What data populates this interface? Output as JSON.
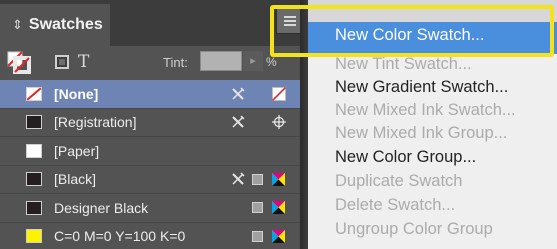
{
  "panel": {
    "title": "Swatches",
    "tint_label": "Tint:",
    "tint_value": "",
    "tint_pct": "%"
  },
  "swatches": [
    {
      "name": "[None]",
      "color": "#ffffff",
      "selected": true,
      "chip": "none",
      "nonedit": true,
      "mode": "none"
    },
    {
      "name": "[Registration]",
      "color": "#231f20",
      "selected": false,
      "chip": "solid",
      "nonedit": true,
      "mode": "registration"
    },
    {
      "name": "[Paper]",
      "color": "#ffffff",
      "selected": false,
      "chip": "solid",
      "nonedit": false,
      "mode": ""
    },
    {
      "name": "[Black]",
      "color": "#231f20",
      "selected": false,
      "chip": "solid",
      "nonedit": true,
      "mode": "process-cmyk"
    },
    {
      "name": "Designer Black",
      "color": "#231f20",
      "selected": false,
      "chip": "solid",
      "nonedit": false,
      "mode": "process-cmyk"
    },
    {
      "name": "C=0 M=0 Y=100 K=0",
      "color": "#fff200",
      "selected": false,
      "chip": "solid",
      "nonedit": false,
      "mode": "process-cmyk"
    }
  ],
  "menu": {
    "items": [
      {
        "label": "New Color Swatch...",
        "state": "active"
      },
      {
        "label": "New Tint Swatch...",
        "state": "disabled"
      },
      {
        "label": "New Gradient Swatch...",
        "state": "enabled"
      },
      {
        "label": "New Mixed Ink Swatch...",
        "state": "disabled"
      },
      {
        "label": "New Mixed Ink Group...",
        "state": "disabled"
      },
      {
        "label": "New Color Group...",
        "state": "enabled"
      },
      {
        "label": "Duplicate Swatch",
        "state": "disabled"
      },
      {
        "label": "Delete Swatch...",
        "state": "disabled"
      },
      {
        "label": "Ungroup Color Group",
        "state": "disabled"
      }
    ]
  },
  "colors": {
    "selection": "#6d84b5",
    "menu_highlight": "#4a8fde",
    "callout": "#f3e21c"
  }
}
